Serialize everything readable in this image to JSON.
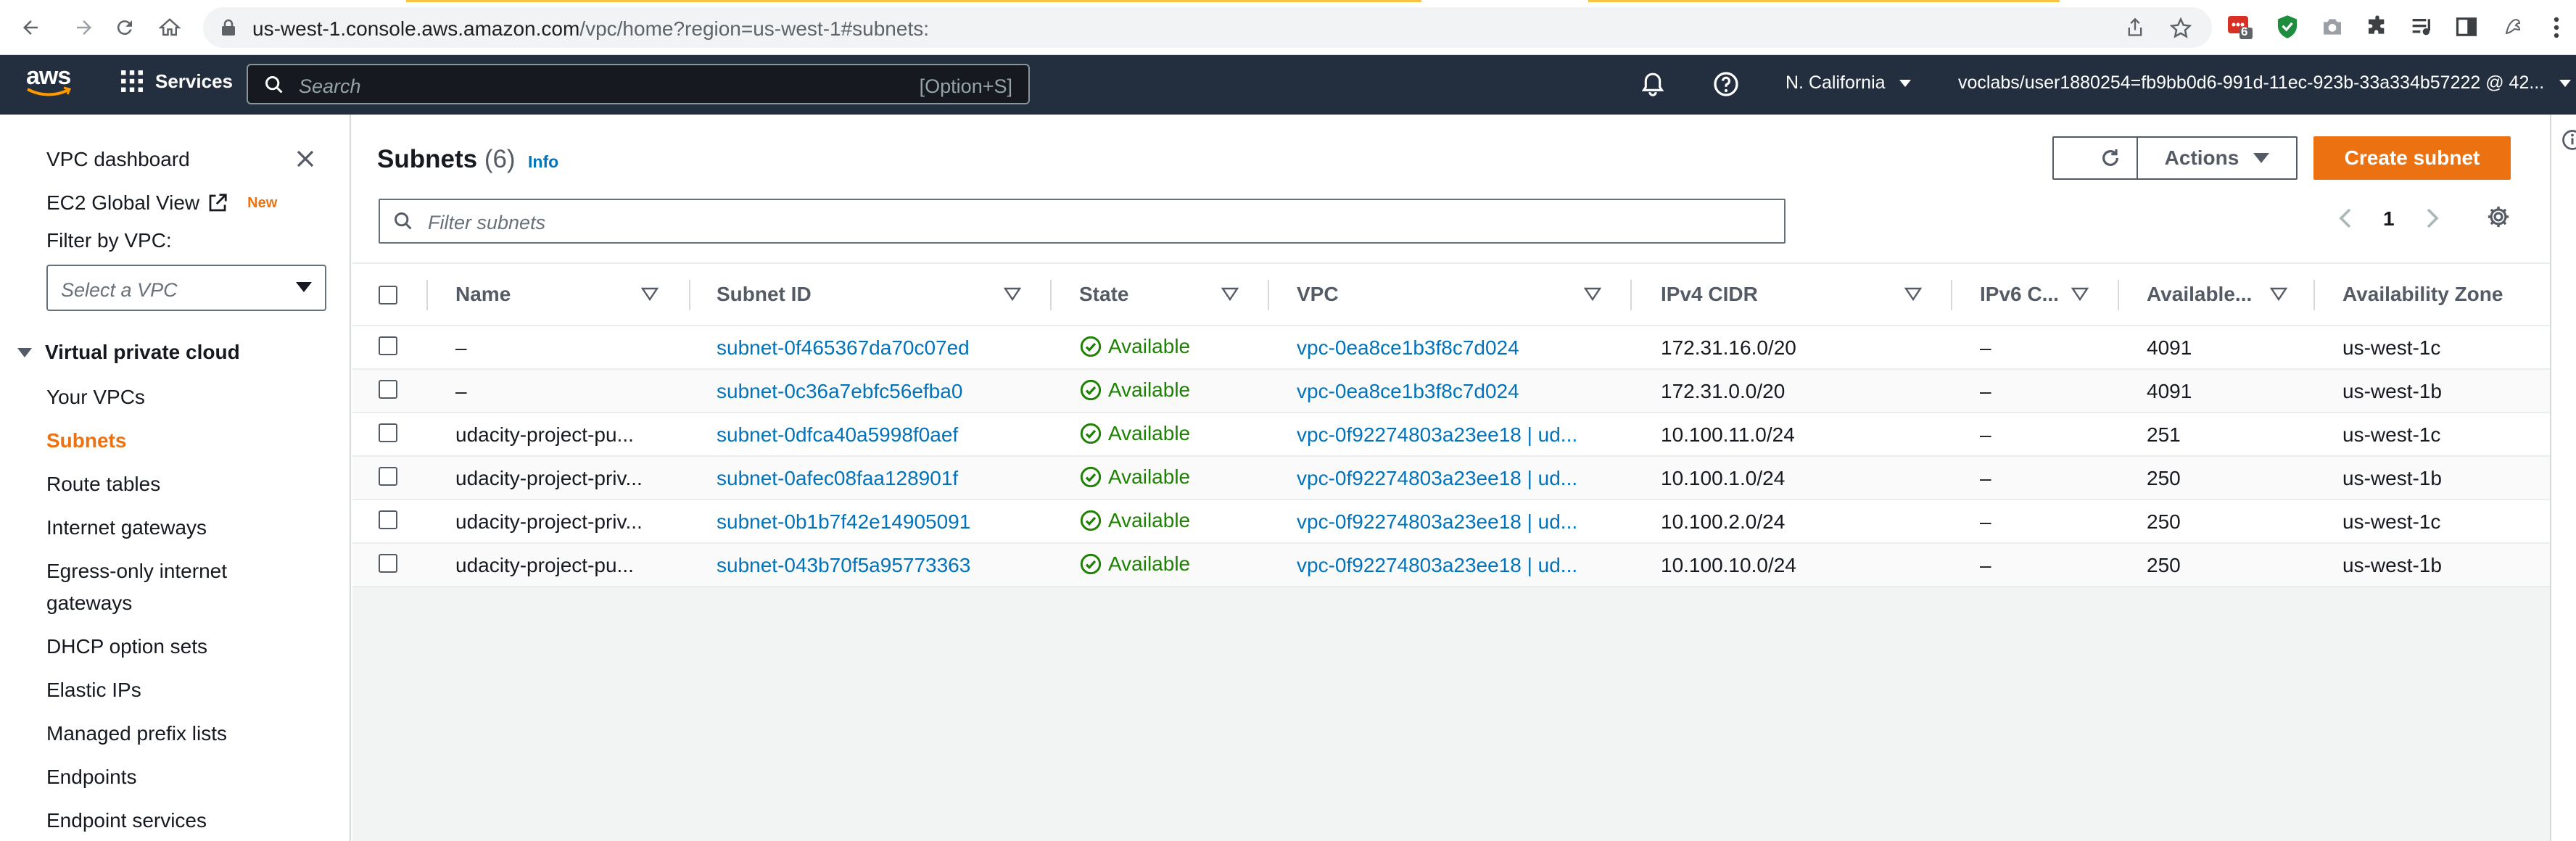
{
  "browser": {
    "url_host": "us-west-1.console.aws.amazon.com",
    "url_path": "/vpc/home?region=us-west-1#subnets:",
    "ext_badge": "6"
  },
  "topnav": {
    "logo": "aws",
    "services_label": "Services",
    "search_placeholder": "Search",
    "search_shortcut": "[Option+S]",
    "region": "N. California",
    "account": "voclabs/user1880254=fb9bb0d6-991d-11ec-923b-33a334b57222 @ 42..."
  },
  "sidebar": {
    "dashboard": "VPC dashboard",
    "ec2_global_view": "EC2 Global View",
    "new_badge": "New",
    "filter_label": "Filter by VPC:",
    "select_placeholder": "Select a VPC",
    "section_title": "Virtual private cloud",
    "items": [
      {
        "label": "Your VPCs"
      },
      {
        "label": "Subnets"
      },
      {
        "label": "Route tables"
      },
      {
        "label": "Internet gateways"
      },
      {
        "label": "Egress-only internet"
      },
      {
        "label": "gateways"
      },
      {
        "label": "DHCP option sets"
      },
      {
        "label": "Elastic IPs"
      },
      {
        "label": "Managed prefix lists"
      },
      {
        "label": "Endpoints"
      },
      {
        "label": "Endpoint services"
      }
    ]
  },
  "header": {
    "title": "Subnets",
    "count": "(6)",
    "info": "Info",
    "actions_label": "Actions",
    "create_label": "Create subnet",
    "filter_placeholder": "Filter subnets",
    "page": "1"
  },
  "table": {
    "columns": [
      "Name",
      "Subnet ID",
      "State",
      "VPC",
      "IPv4 CIDR",
      "IPv6 C...",
      "Available...",
      "Availability Zone"
    ],
    "rows": [
      {
        "name": "–",
        "subnet_id": "subnet-0f465367da70c07ed",
        "state": "Available",
        "vpc": "vpc-0ea8ce1b3f8c7d024",
        "ipv4": "172.31.16.0/20",
        "ipv6": "–",
        "available": "4091",
        "az": "us-west-1c"
      },
      {
        "name": "–",
        "subnet_id": "subnet-0c36a7ebfc56efba0",
        "state": "Available",
        "vpc": "vpc-0ea8ce1b3f8c7d024",
        "ipv4": "172.31.0.0/20",
        "ipv6": "–",
        "available": "4091",
        "az": "us-west-1b"
      },
      {
        "name": "udacity-project-pu...",
        "subnet_id": "subnet-0dfca40a5998f0aef",
        "state": "Available",
        "vpc": "vpc-0f92274803a23ee18 | ud...",
        "ipv4": "10.100.11.0/24",
        "ipv6": "–",
        "available": "251",
        "az": "us-west-1c"
      },
      {
        "name": "udacity-project-priv...",
        "subnet_id": "subnet-0afec08faa128901f",
        "state": "Available",
        "vpc": "vpc-0f92274803a23ee18 | ud...",
        "ipv4": "10.100.1.0/24",
        "ipv6": "–",
        "available": "250",
        "az": "us-west-1b"
      },
      {
        "name": "udacity-project-priv...",
        "subnet_id": "subnet-0b1b7f42e14905091",
        "state": "Available",
        "vpc": "vpc-0f92274803a23ee18 | ud...",
        "ipv4": "10.100.2.0/24",
        "ipv6": "–",
        "available": "250",
        "az": "us-west-1c"
      },
      {
        "name": "udacity-project-pu...",
        "subnet_id": "subnet-043b70f5a95773363",
        "state": "Available",
        "vpc": "vpc-0f92274803a23ee18 | ud...",
        "ipv4": "10.100.10.0/24",
        "ipv6": "–",
        "available": "250",
        "az": "us-west-1b"
      }
    ]
  },
  "colors": {
    "aws_nav": "#232f3e",
    "accent_orange": "#ec7211",
    "link_blue": "#0073bb",
    "available_green": "#1d8102"
  }
}
